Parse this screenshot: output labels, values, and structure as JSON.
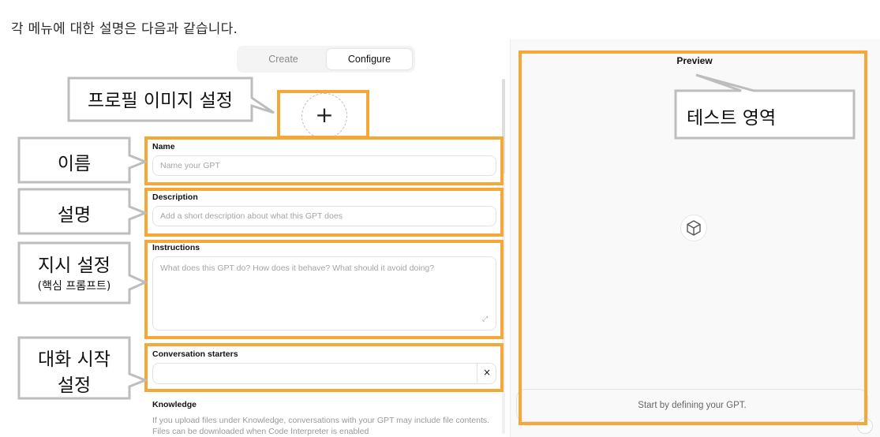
{
  "caption": "각 메뉴에 대한 설명은 다음과 같습니다.",
  "editor": {
    "tabs": [
      {
        "label": "Create",
        "active": false
      },
      {
        "label": "Configure",
        "active": true
      }
    ],
    "avatar_symbol": "+",
    "name": {
      "label": "Name",
      "placeholder": "Name your GPT"
    },
    "description": {
      "label": "Description",
      "placeholder": "Add a short description about what this GPT does"
    },
    "instructions": {
      "label": "Instructions",
      "placeholder": "What does this GPT do? How does it behave? What should it avoid doing?"
    },
    "conversation_starters": {
      "label": "Conversation starters",
      "value": "",
      "remove_symbol": "×"
    },
    "knowledge": {
      "label": "Knowledge",
      "description_line1": "If you upload files under Knowledge, conversations with your GPT may include file contents.",
      "description_line2": "Files can be downloaded when Code Interpreter is enabled"
    }
  },
  "preview": {
    "title": "Preview",
    "input_placeholder": "Start by defining your GPT."
  },
  "annotations": {
    "profile_image": "프로필 이미지 설정",
    "name": "이름",
    "description": "설명",
    "instructions_line1": "지시 설정",
    "instructions_line2": "(핵심 프롬프트)",
    "starters_line1": "대화 시작",
    "starters_line2": "설정",
    "test_area": "테스트 영역"
  },
  "colors": {
    "annotation_frame": "#f5a838",
    "callout_fill": "#ffffff",
    "callout_border": "#bdbdbd"
  }
}
